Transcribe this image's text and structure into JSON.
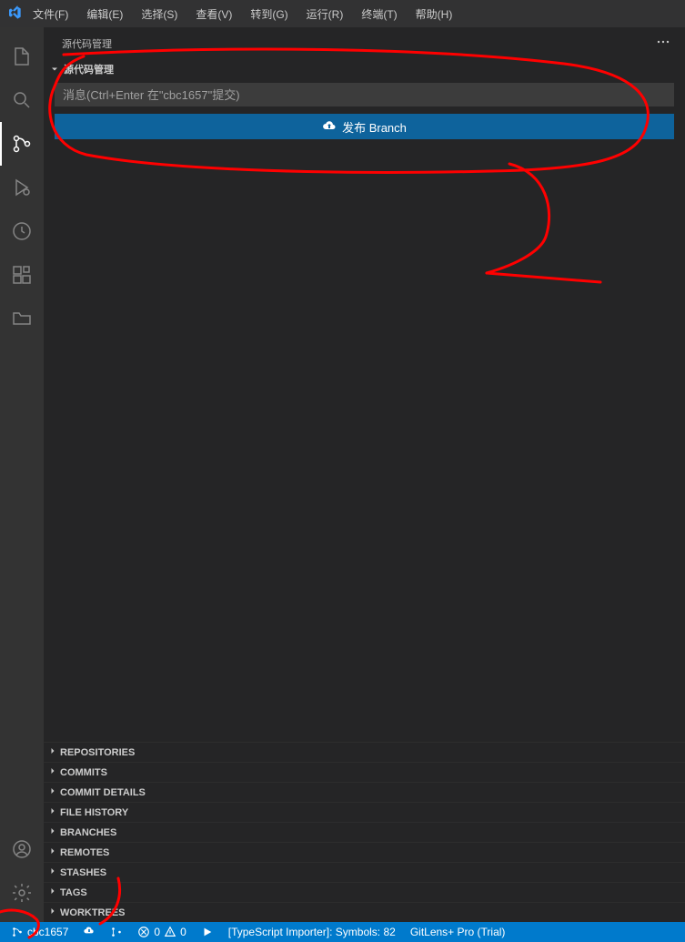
{
  "menubar": {
    "items": [
      "文件(F)",
      "编辑(E)",
      "选择(S)",
      "查看(V)",
      "转到(G)",
      "运行(R)",
      "终端(T)",
      "帮助(H)"
    ]
  },
  "sidebar": {
    "title": "源代码管理",
    "scm_section_label": "源代码管理",
    "commit_placeholder": "消息(Ctrl+Enter 在\"cbc1657\"提交)",
    "publish_label": "发布 Branch"
  },
  "bottom_sections": [
    "REPOSITORIES",
    "COMMITS",
    "COMMIT DETAILS",
    "FILE HISTORY",
    "BRANCHES",
    "REMOTES",
    "STASHES",
    "TAGS",
    "WORKTREES"
  ],
  "statusbar": {
    "branch": "cbc1657",
    "errors": "0",
    "warnings": "0",
    "ts_importer": "[TypeScript Importer]: Symbols: 82",
    "gitlens": "GitLens+ Pro (Trial)"
  },
  "colors": {
    "accent": "#007acc",
    "button": "#0e639c",
    "annotation": "#ff0000"
  }
}
